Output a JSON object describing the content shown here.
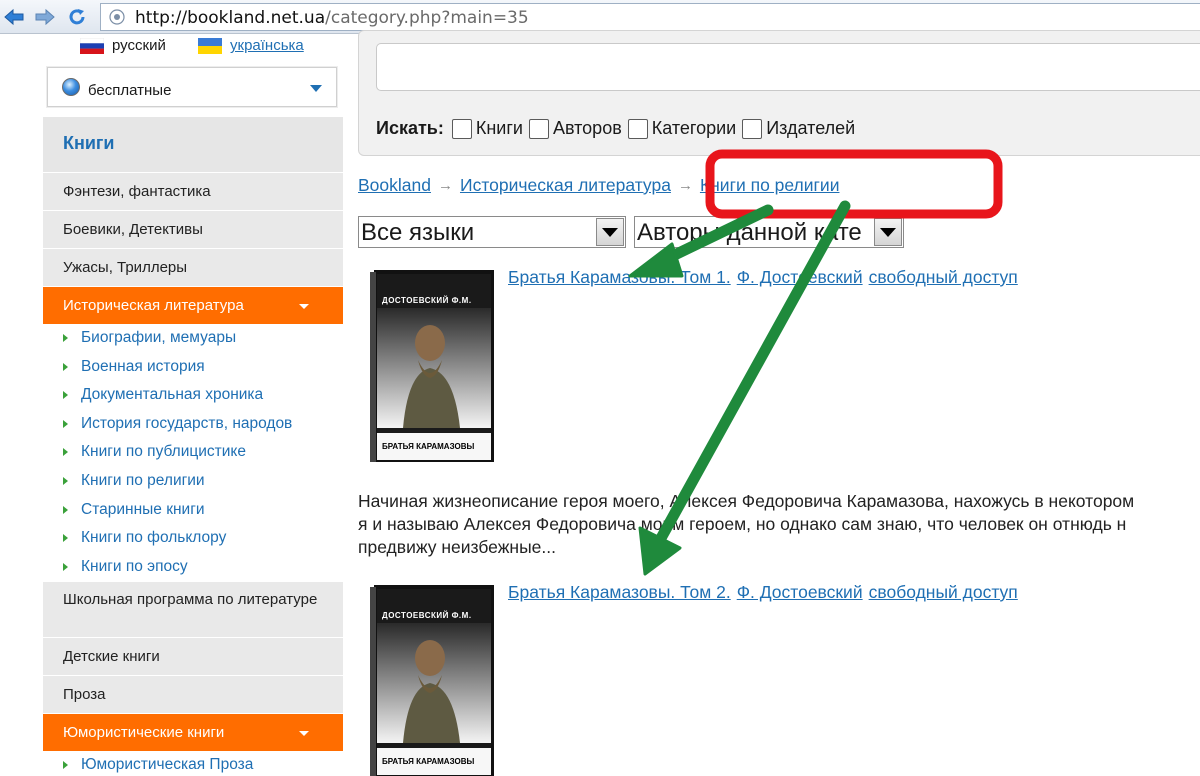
{
  "browser": {
    "url_host": "http://bookland.net.ua",
    "url_path": "/category.php?main=35"
  },
  "lang": {
    "russian": "русский",
    "ukrainian": "українська"
  },
  "filter": {
    "selected": "бесплатные"
  },
  "sidebar": {
    "heading": "Книги",
    "items": [
      "Фэнтези, фантастика",
      "Боевики, Детективы",
      "Ужасы, Триллеры",
      "Историческая литература"
    ],
    "sub_items": [
      "Биографии, мемуары",
      "Военная история",
      "Документальная хроника",
      "История государств, народов",
      "Книги по публицистике",
      "Книги по религии",
      "Старинные книги",
      "Книги по фольклору",
      "Книги по эпосу"
    ],
    "items_after": [
      "Школьная программа по литературе",
      "Детские книги",
      "Проза",
      "Юмористические книги"
    ],
    "sub_after": [
      "Юмористическая Проза"
    ]
  },
  "search": {
    "label": "Искать:",
    "options": [
      "Книги",
      "Авторов",
      "Категории",
      "Издателей"
    ]
  },
  "breadcrumb": [
    "Bookland",
    "Историческая литература",
    "Книги по религии"
  ],
  "dropdowns": {
    "languages": "Все языки",
    "authors": "Авторы данной кате"
  },
  "books": [
    {
      "title": "Братья Карамазовы. Том 1.",
      "author": "Ф. Достоевский",
      "access": "свободный доступ",
      "cover_author": "ДОСТОЕВСКИЙ Ф.М.",
      "cover_title": "БРАТЬЯ КАРАМАЗОВЫ"
    },
    {
      "title": "Братья Карамазовы. Том 2.",
      "author": "Ф. Достоевский",
      "access": "свободный доступ",
      "cover_author": "ДОСТОЕВСКИЙ Ф.М.",
      "cover_title": "БРАТЬЯ КАРАМАЗОВЫ"
    }
  ],
  "description_lines": [
    "Начиная жизнеописание героя моего, Алексея Федоровича Карамазова, нахожусь в некотором",
    "я и называю Алексея Федоровича моим героем, но однако сам знаю, что человек он отнюдь н",
    "предвижу неизбежные..."
  ],
  "colors": {
    "accent": "#ff6d00",
    "link": "#1f6fb3",
    "annotation_red": "#e8151b",
    "annotation_green": "#1f8a3c"
  }
}
